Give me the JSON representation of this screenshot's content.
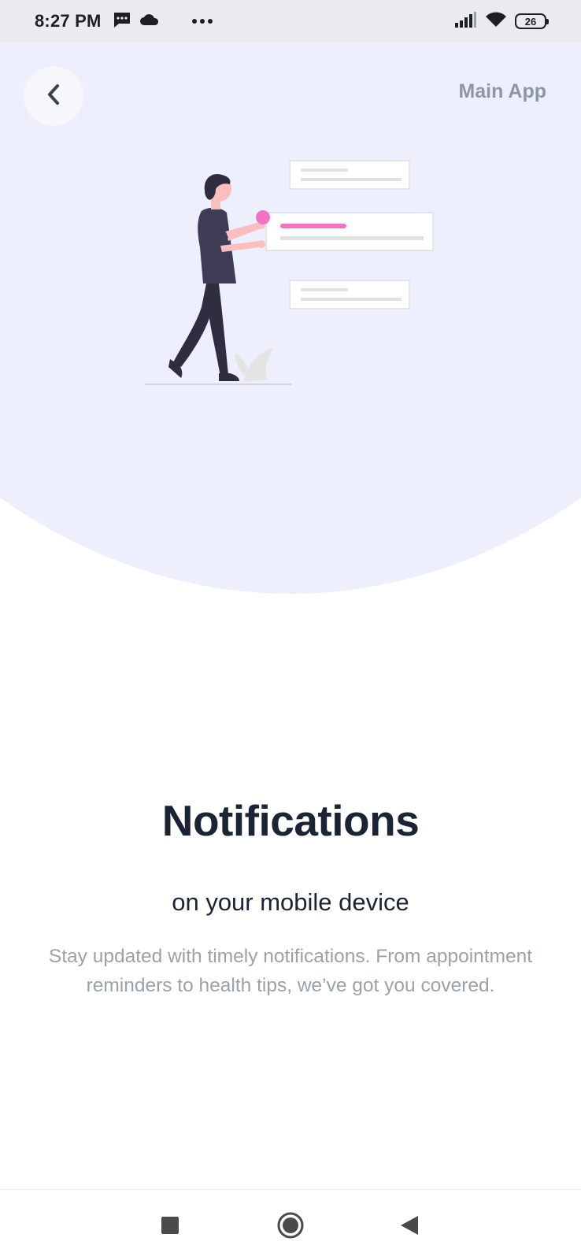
{
  "status_bar": {
    "time": "8:27 PM",
    "battery": "26",
    "icons": [
      "message-icon",
      "cloud-icon",
      "more-dots-icon",
      "signal-icon",
      "wifi-icon",
      "battery-icon"
    ]
  },
  "header": {
    "back_icon": "chevron-left-icon",
    "main_app_label": "Main App"
  },
  "illustration": {
    "name": "person-with-notifications",
    "accent_color": "#f472c4"
  },
  "content": {
    "title": "Notifications",
    "subtitle": "on your mobile device",
    "description": "Stay updated with timely notifications. From appointment reminders to health tips, we’ve got you covered."
  },
  "nav_bar": {
    "icons": [
      "recents-square-icon",
      "home-circle-icon",
      "back-triangle-icon"
    ]
  },
  "colors": {
    "hero_background": "#edf0fc",
    "title": "#1b2435",
    "muted": "#9ba1ab",
    "accent": "#f472c4"
  }
}
